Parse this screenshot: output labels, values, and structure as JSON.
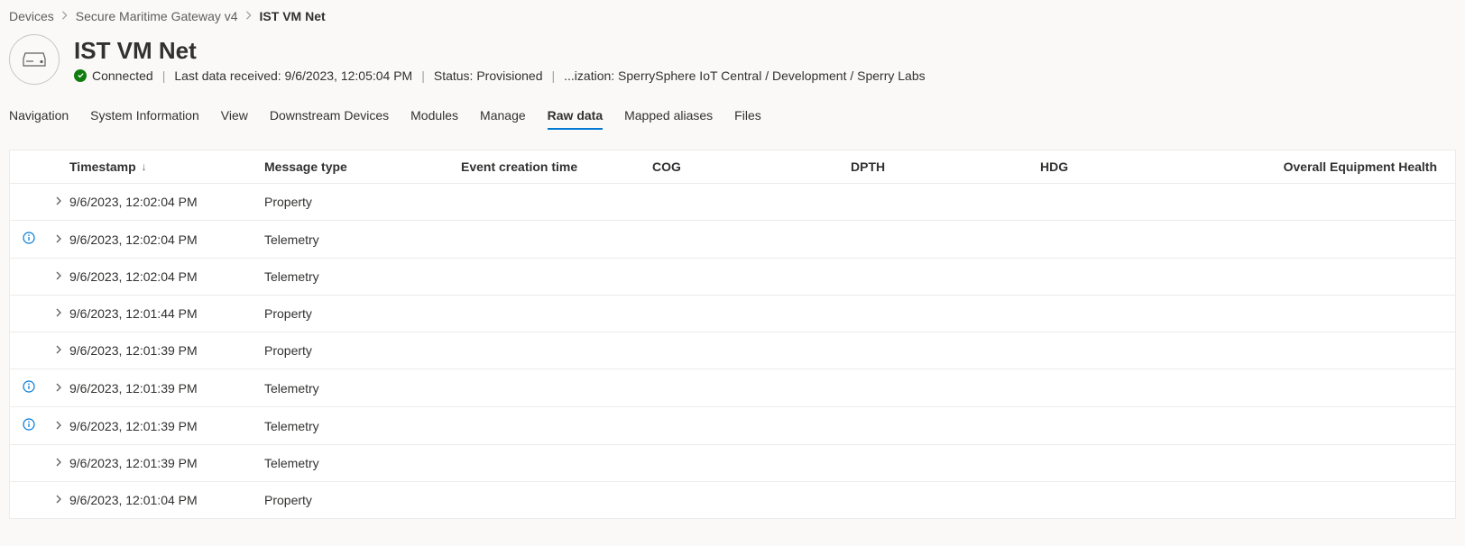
{
  "breadcrumb": {
    "items": [
      {
        "label": "Devices"
      },
      {
        "label": "Secure Maritime Gateway v4"
      }
    ],
    "current": "IST VM Net"
  },
  "header": {
    "title": "IST VM Net",
    "status_connected": "Connected",
    "last_data_received": "Last data received: 9/6/2023, 12:05:04 PM",
    "status_provisioned": "Status: Provisioned",
    "organization": "...ization: SperrySphere IoT Central / Development / Sperry Labs"
  },
  "tabs": [
    {
      "label": "Navigation",
      "active": false
    },
    {
      "label": "System Information",
      "active": false
    },
    {
      "label": "View",
      "active": false
    },
    {
      "label": "Downstream Devices",
      "active": false
    },
    {
      "label": "Modules",
      "active": false
    },
    {
      "label": "Manage",
      "active": false
    },
    {
      "label": "Raw data",
      "active": true
    },
    {
      "label": "Mapped aliases",
      "active": false
    },
    {
      "label": "Files",
      "active": false
    }
  ],
  "table": {
    "columns": {
      "timestamp": "Timestamp",
      "message_type": "Message type",
      "event_creation_time": "Event creation time",
      "cog": "COG",
      "dpth": "DPTH",
      "hdg": "HDG",
      "overall_health": "Overall Equipment Health"
    },
    "rows": [
      {
        "timestamp": "9/6/2023, 12:02:04 PM",
        "message_type": "Property",
        "info": false
      },
      {
        "timestamp": "9/6/2023, 12:02:04 PM",
        "message_type": "Telemetry",
        "info": true
      },
      {
        "timestamp": "9/6/2023, 12:02:04 PM",
        "message_type": "Telemetry",
        "info": false
      },
      {
        "timestamp": "9/6/2023, 12:01:44 PM",
        "message_type": "Property",
        "info": false
      },
      {
        "timestamp": "9/6/2023, 12:01:39 PM",
        "message_type": "Property",
        "info": false
      },
      {
        "timestamp": "9/6/2023, 12:01:39 PM",
        "message_type": "Telemetry",
        "info": true
      },
      {
        "timestamp": "9/6/2023, 12:01:39 PM",
        "message_type": "Telemetry",
        "info": true
      },
      {
        "timestamp": "9/6/2023, 12:01:39 PM",
        "message_type": "Telemetry",
        "info": false
      },
      {
        "timestamp": "9/6/2023, 12:01:04 PM",
        "message_type": "Property",
        "info": false
      }
    ]
  }
}
